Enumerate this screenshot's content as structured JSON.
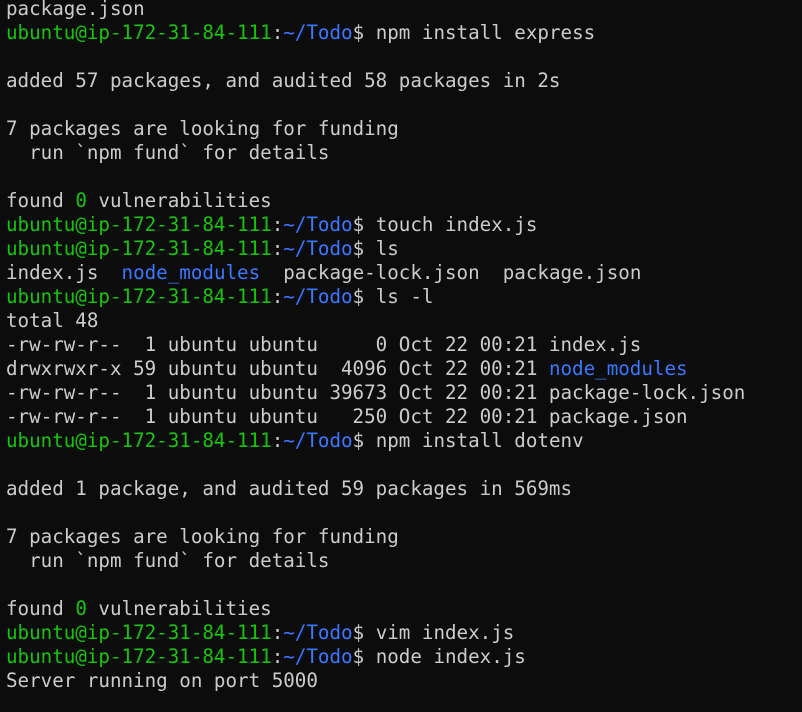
{
  "colors": {
    "background": "#0c0c0c",
    "text": "#cccccc",
    "prompt_user": "#16c60c",
    "prompt_path": "#3b78ff",
    "directory": "#3b78ff",
    "highlight_number": "#16c60c"
  },
  "prompt": {
    "user_host": "ubuntu@ip-172-31-84-111",
    "sep": ":",
    "path": "~/Todo",
    "suffix": "$ "
  },
  "lines": [
    {
      "type": "plain",
      "segments": [
        {
          "text": "package.json",
          "color": "default"
        }
      ]
    },
    {
      "type": "prompt",
      "cmd": "npm install express"
    },
    {
      "type": "plain",
      "segments": []
    },
    {
      "type": "plain",
      "segments": [
        {
          "text": "added 57 packages, and audited 58 packages in 2s",
          "color": "default"
        }
      ]
    },
    {
      "type": "plain",
      "segments": []
    },
    {
      "type": "plain",
      "segments": [
        {
          "text": "7 packages are looking for funding",
          "color": "default"
        }
      ]
    },
    {
      "type": "plain",
      "segments": [
        {
          "text": "  run `npm fund` for details",
          "color": "default"
        }
      ]
    },
    {
      "type": "plain",
      "segments": []
    },
    {
      "type": "plain",
      "segments": [
        {
          "text": "found ",
          "color": "default"
        },
        {
          "text": "0",
          "color": "green"
        },
        {
          "text": " vulnerabilities",
          "color": "default"
        }
      ]
    },
    {
      "type": "prompt",
      "cmd": "touch index.js"
    },
    {
      "type": "prompt",
      "cmd": "ls"
    },
    {
      "type": "plain",
      "segments": [
        {
          "text": "index.js  ",
          "color": "default"
        },
        {
          "text": "node_modules",
          "color": "blue"
        },
        {
          "text": "  package-lock.json  package.json",
          "color": "default"
        }
      ]
    },
    {
      "type": "prompt",
      "cmd": "ls -l"
    },
    {
      "type": "plain",
      "segments": [
        {
          "text": "total 48",
          "color": "default"
        }
      ]
    },
    {
      "type": "plain",
      "segments": [
        {
          "text": "-rw-rw-r--  1 ubuntu ubuntu     0 Oct 22 00:21 index.js",
          "color": "default"
        }
      ]
    },
    {
      "type": "plain",
      "segments": [
        {
          "text": "drwxrwxr-x 59 ubuntu ubuntu  4096 Oct 22 00:21 ",
          "color": "default"
        },
        {
          "text": "node_modules",
          "color": "blue"
        }
      ]
    },
    {
      "type": "plain",
      "segments": [
        {
          "text": "-rw-rw-r--  1 ubuntu ubuntu 39673 Oct 22 00:21 package-lock.json",
          "color": "default"
        }
      ]
    },
    {
      "type": "plain",
      "segments": [
        {
          "text": "-rw-rw-r--  1 ubuntu ubuntu   250 Oct 22 00:21 package.json",
          "color": "default"
        }
      ]
    },
    {
      "type": "prompt",
      "cmd": "npm install dotenv"
    },
    {
      "type": "plain",
      "segments": []
    },
    {
      "type": "plain",
      "segments": [
        {
          "text": "added 1 package, and audited 59 packages in 569ms",
          "color": "default"
        }
      ]
    },
    {
      "type": "plain",
      "segments": []
    },
    {
      "type": "plain",
      "segments": [
        {
          "text": "7 packages are looking for funding",
          "color": "default"
        }
      ]
    },
    {
      "type": "plain",
      "segments": [
        {
          "text": "  run `npm fund` for details",
          "color": "default"
        }
      ]
    },
    {
      "type": "plain",
      "segments": []
    },
    {
      "type": "plain",
      "segments": [
        {
          "text": "found ",
          "color": "default"
        },
        {
          "text": "0",
          "color": "green"
        },
        {
          "text": " vulnerabilities",
          "color": "default"
        }
      ]
    },
    {
      "type": "prompt",
      "cmd": "vim index.js"
    },
    {
      "type": "prompt",
      "cmd": "node index.js"
    },
    {
      "type": "plain",
      "segments": [
        {
          "text": "Server running on port 5000",
          "color": "default"
        }
      ]
    }
  ]
}
